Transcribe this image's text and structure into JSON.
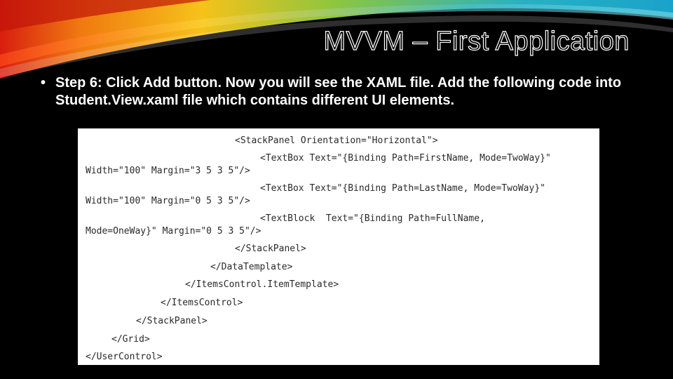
{
  "slide": {
    "title": "MVVM – First Application",
    "bullet_marker": "•",
    "bullet_text": "Step 6: Click Add button. Now you will see the XAML file. Add the following code into Student.View.xaml file which contains different UI elements."
  },
  "code_lines": [
    "<StackPanel Orientation=\"Horizontal\">",
    "<TextBox Text=\"{Binding Path=FirstName, Mode=TwoWay}\"",
    "Width=\"100\" Margin=\"3 5 3 5\"/>",
    "<TextBox Text=\"{Binding Path=LastName, Mode=TwoWay}\"",
    "Width=\"100\" Margin=\"0 5 3 5\"/>",
    "<TextBlock  Text=\"{Binding Path=FullName,",
    "Mode=OneWay}\" Margin=\"0 5 3 5\"/>",
    "</StackPanel>",
    "</DataTemplate>",
    "</ItemsControl.ItemTemplate>",
    "</ItemsControl>",
    "</StackPanel>",
    "</Grid>",
    "</UserControl>"
  ],
  "colors": {
    "background": "#000000",
    "swoosh_red": "#d81e0f",
    "swoosh_orange": "#f07a10",
    "swoosh_yellow": "#f6c21a",
    "swoosh_green": "#8cc63f",
    "swoosh_teal": "#27b0c4"
  }
}
